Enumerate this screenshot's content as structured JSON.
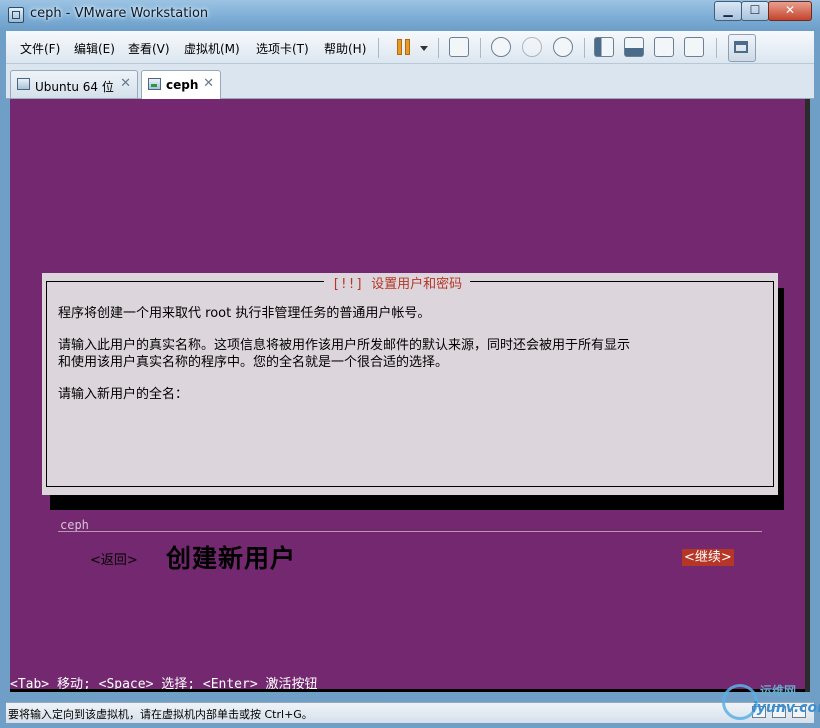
{
  "window": {
    "title": "ceph - VMware Workstation",
    "minimize": "▁",
    "maximize": "☐",
    "close": "✕"
  },
  "menu": [
    "文件(F)",
    "编辑(E)",
    "查看(V)",
    "虚拟机(M)",
    "选项卡(T)",
    "帮助(H)"
  ],
  "toolbar_icons": [
    "pause-icon",
    "network-icon",
    "snapshot-take-icon",
    "snapshot-revert-icon",
    "snapshot-manager-icon",
    "sidebar-icon",
    "thumbnail-bar-icon",
    "fullscreen-icon",
    "unity-icon",
    "console-view-icon"
  ],
  "tabs": [
    {
      "label": "Ubuntu 64 位",
      "close": "✕"
    },
    {
      "label": "ceph",
      "close": "✕"
    }
  ],
  "installer": {
    "title": "[!!] 设置用户和密码",
    "line1": "程序将创建一个用来取代 root 执行非管理任务的普通用户帐号。",
    "line2a": "请输入此用户的真实名称。这项信息将被用作该用户所发邮件的默认来源，同时还会被用于所有显示",
    "line2b": "和使用该用户真实名称的程序中。您的全名就是一个很合适的选择。",
    "prompt": "请输入新用户的全名：",
    "fullname_value": "ceph",
    "back_label": "<返回>",
    "continue_label": "<继续>",
    "caption": "创建新用户",
    "hint": "<Tab> 移动; <Space> 选择; <Enter> 激活按钮"
  },
  "statusbar": {
    "text": "要将输入定向到该虚拟机，请在虚拟机内部单击或按 Ctrl+G。"
  },
  "watermark": {
    "line1": "运维网",
    "line2": "iyunv.com"
  },
  "colors": {
    "vm_background": "#732870",
    "dialog_background": "#dcd6dc",
    "accent_red": "#b53526"
  }
}
